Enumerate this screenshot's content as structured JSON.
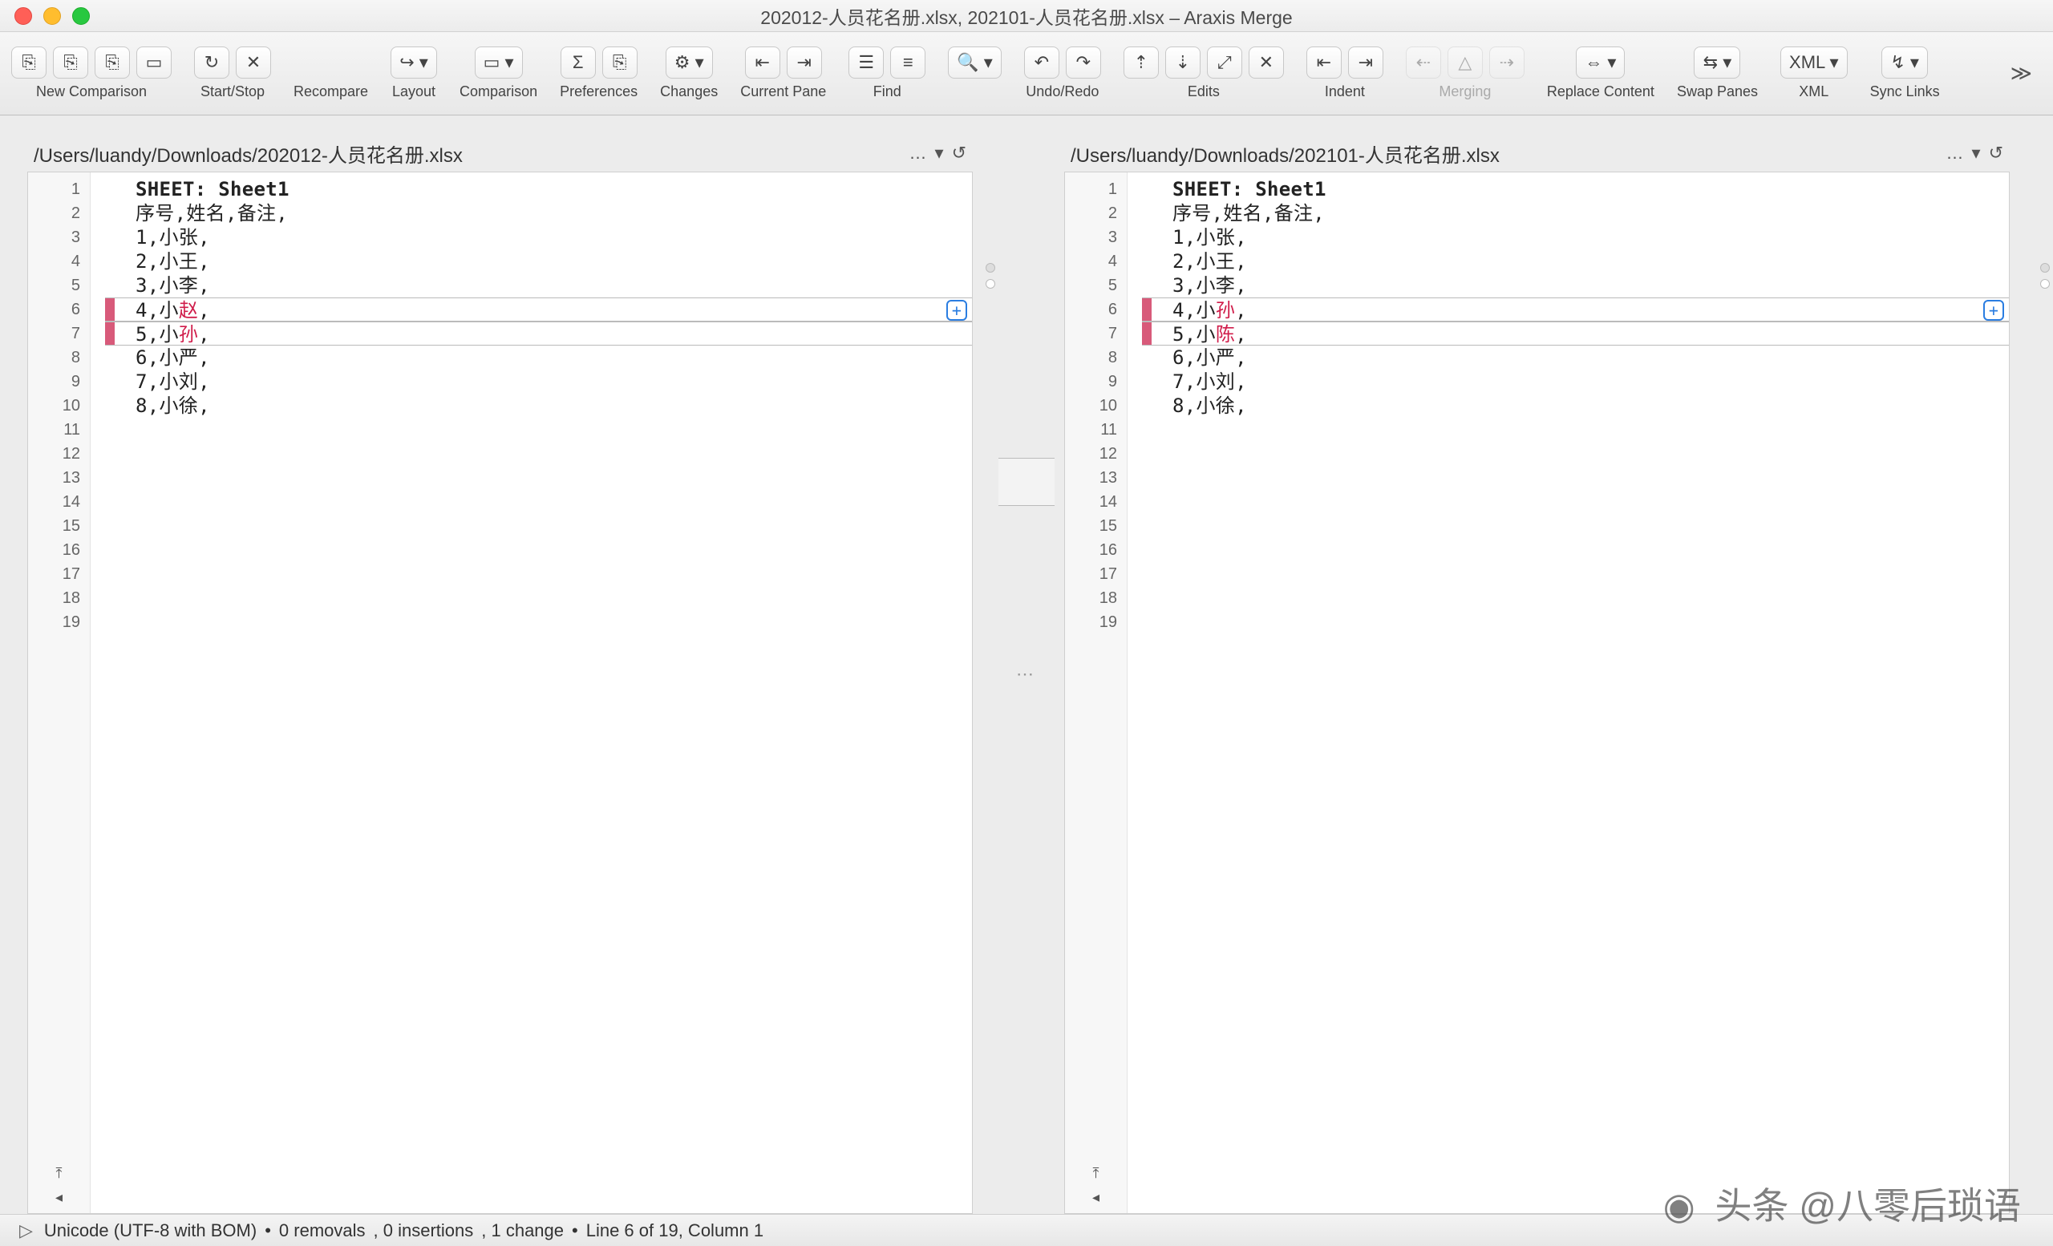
{
  "window": {
    "title": "202012-人员花名册.xlsx, 202101-人员花名册.xlsx – Araxis Merge"
  },
  "toolbar": {
    "new_comparison": "New Comparison",
    "start_stop": "Start/Stop",
    "recompare": "Recompare",
    "layout": "Layout",
    "comparison": "Comparison",
    "preferences": "Preferences",
    "changes": "Changes",
    "current_pane": "Current Pane",
    "find": "Find",
    "undo_redo": "Undo/Redo",
    "edits": "Edits",
    "indent": "Indent",
    "merging": "Merging",
    "replace_content": "Replace Content",
    "swap_panes": "Swap Panes",
    "xml": "XML",
    "sync_links": "Sync Links"
  },
  "left_pane": {
    "path": "/Users/luandy/Downloads/202012-人员花名册.xlsx",
    "sheet_header": "SHEET: Sheet1",
    "line2": "序号,姓名,备注,",
    "lines": [
      {
        "n": "1",
        "t": "1,小张,"
      },
      {
        "n": "2",
        "t": "2,小王,"
      },
      {
        "n": "3",
        "t": "3,小李,"
      },
      {
        "n": "4",
        "t": "4,小",
        "c": "赵",
        "r": ","
      },
      {
        "n": "5",
        "t": "5,小",
        "c": "孙",
        "r": ","
      },
      {
        "n": "6",
        "t": "6,小严,"
      },
      {
        "n": "7",
        "t": "7,小刘,"
      },
      {
        "n": "8",
        "t": "8,小徐,"
      }
    ],
    "ins_btn": "+"
  },
  "right_pane": {
    "path": "/Users/luandy/Downloads/202101-人员花名册.xlsx",
    "sheet_header": "SHEET: Sheet1",
    "line2": "序号,姓名,备注,",
    "lines": [
      {
        "n": "1",
        "t": "1,小张,"
      },
      {
        "n": "2",
        "t": "2,小王,"
      },
      {
        "n": "3",
        "t": "3,小李,"
      },
      {
        "n": "4",
        "t": "4,小",
        "c": "孙",
        "r": ","
      },
      {
        "n": "5",
        "t": "5,小",
        "c": "陈",
        "r": ","
      },
      {
        "n": "6",
        "t": "6,小严,"
      },
      {
        "n": "7",
        "t": "7,小刘,"
      },
      {
        "n": "8",
        "t": "8,小徐,"
      }
    ],
    "ins_btn": "+"
  },
  "line_numbers": [
    "1",
    "2",
    "3",
    "4",
    "5",
    "6",
    "7",
    "8",
    "9",
    "10",
    "11",
    "12",
    "13",
    "14",
    "15",
    "16",
    "17",
    "18",
    "19"
  ],
  "status": {
    "encoding": "Unicode (UTF-8 with BOM)",
    "removals": "0 removals",
    "insertions": "0 insertions",
    "changes": "1 change",
    "position": "Line 6 of 19, Column 1"
  },
  "watermark": "头条 @八零后琐语"
}
